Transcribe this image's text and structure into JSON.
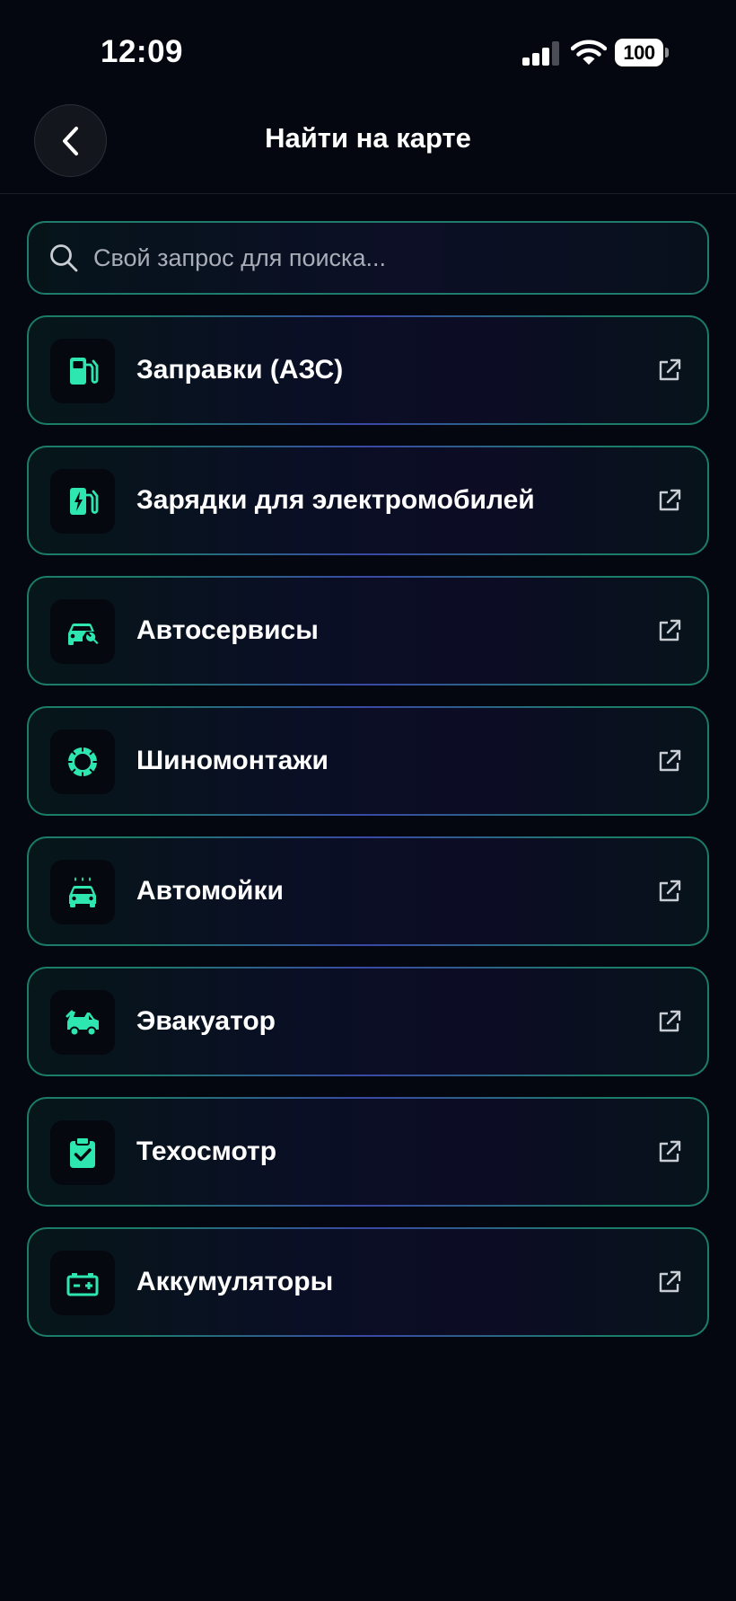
{
  "status_bar": {
    "time": "12:09",
    "battery": "100"
  },
  "header": {
    "title": "Найти на карте"
  },
  "search": {
    "placeholder": "Свой запрос для поиска..."
  },
  "colors": {
    "accent": "#2ee6b0",
    "border": "#1c7c6a",
    "background": "#04070f"
  },
  "items": [
    {
      "label": "Заправки (АЗС)",
      "icon": "fuel-pump-icon"
    },
    {
      "label": "Зарядки для электромобилей",
      "icon": "ev-charger-icon"
    },
    {
      "label": "Автосервисы",
      "icon": "car-repair-icon"
    },
    {
      "label": "Шиномонтажи",
      "icon": "tire-icon"
    },
    {
      "label": "Автомойки",
      "icon": "car-wash-icon"
    },
    {
      "label": "Эвакуатор",
      "icon": "tow-truck-icon"
    },
    {
      "label": "Техосмотр",
      "icon": "inspection-clipboard-icon"
    },
    {
      "label": "Аккумуляторы",
      "icon": "battery-icon"
    }
  ]
}
